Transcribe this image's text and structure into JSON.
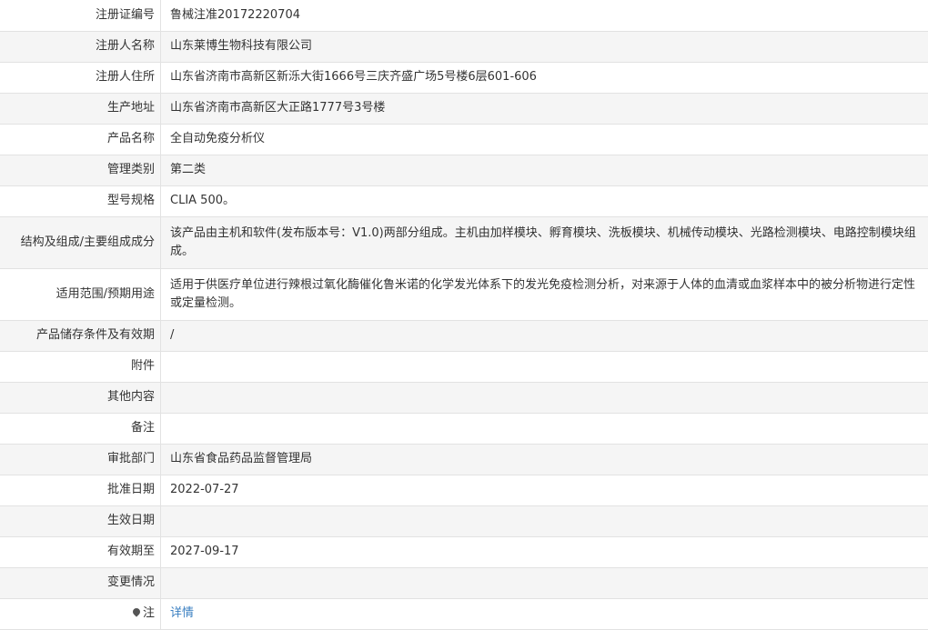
{
  "rows": [
    {
      "label": "注册证编号",
      "value": "鲁械注准20172220704"
    },
    {
      "label": "注册人名称",
      "value": "山东莱博生物科技有限公司"
    },
    {
      "label": "注册人住所",
      "value": "山东省济南市高新区新泺大街1666号三庆齐盛广场5号楼6层601-606"
    },
    {
      "label": "生产地址",
      "value": "山东省济南市高新区大正路1777号3号楼"
    },
    {
      "label": "产品名称",
      "value": "全自动免疫分析仪"
    },
    {
      "label": "管理类别",
      "value": "第二类"
    },
    {
      "label": "型号规格",
      "value": "CLIA 500。"
    },
    {
      "label": "结构及组成/主要组成成分",
      "value": "该产品由主机和软件(发布版本号：V1.0)两部分组成。主机由加样模块、孵育模块、洗板模块、机械传动模块、光路检测模块、电路控制模块组成。"
    },
    {
      "label": "适用范围/预期用途",
      "value": "适用于供医疗单位进行辣根过氧化酶催化鲁米诺的化学发光体系下的发光免疫检测分析，对来源于人体的血清或血浆样本中的被分析物进行定性或定量检测。"
    },
    {
      "label": "产品储存条件及有效期",
      "value": "/"
    },
    {
      "label": "附件",
      "value": ""
    },
    {
      "label": "其他内容",
      "value": ""
    },
    {
      "label": "备注",
      "value": ""
    },
    {
      "label": "审批部门",
      "value": "山东省食品药品监督管理局"
    },
    {
      "label": "批准日期",
      "value": "2022-07-27"
    },
    {
      "label": "生效日期",
      "value": ""
    },
    {
      "label": "有效期至",
      "value": "2027-09-17"
    },
    {
      "label": "变更情况",
      "value": ""
    }
  ],
  "note": {
    "label": "注",
    "icon": "pin-icon",
    "link_text": "详情",
    "link_color": "#3a7fc1"
  }
}
